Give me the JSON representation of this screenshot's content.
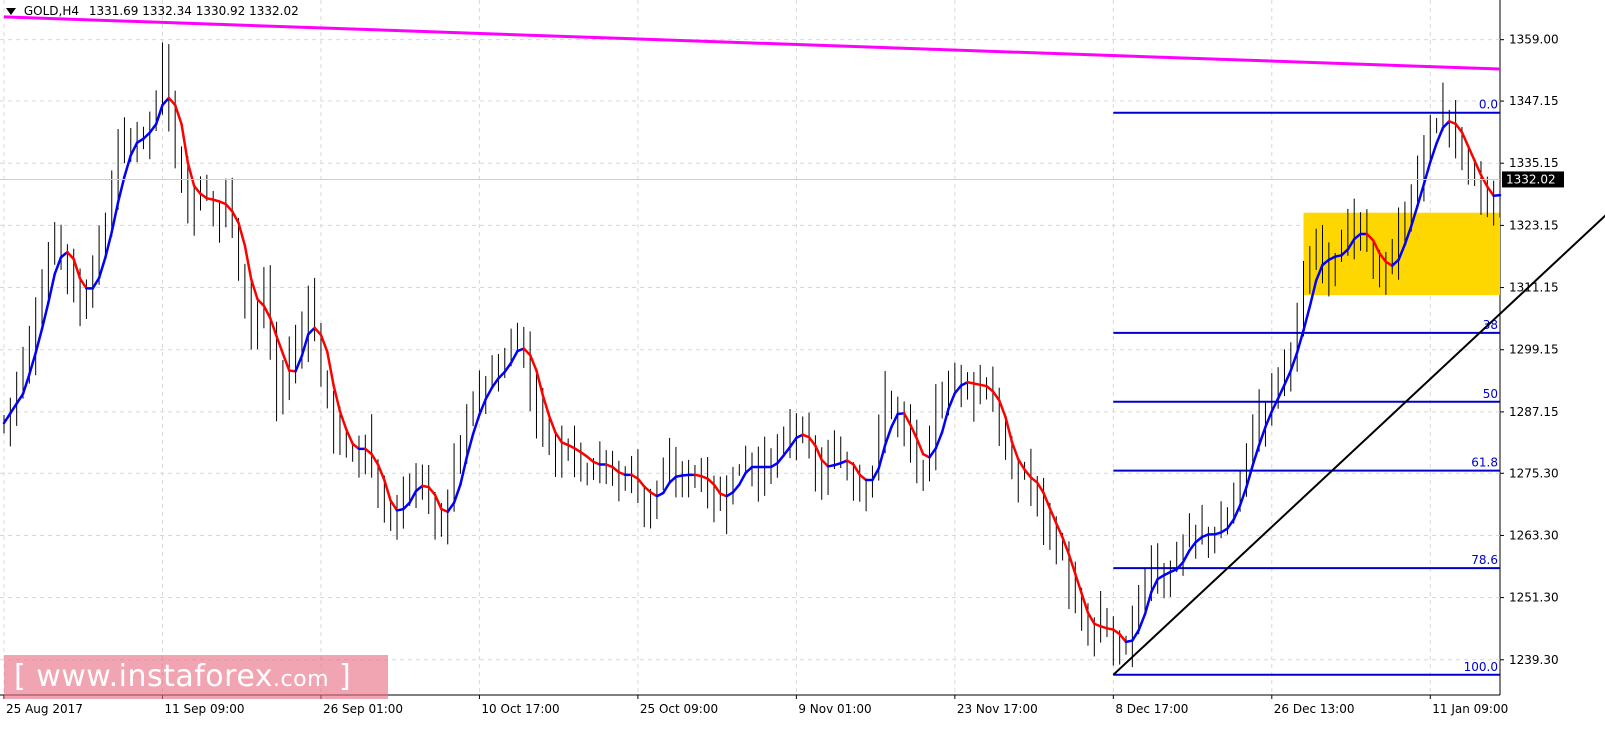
{
  "header": {
    "symbol": "GOLD,H4",
    "ohlc": "1331.69 1332.34 1330.92 1332.02"
  },
  "logo": {
    "open": "[",
    "www": "www.",
    "brand": "instaforex",
    "com": ".com",
    "close": "]"
  },
  "colors": {
    "trend_line": "#ff00ff",
    "fib": "#0000cc",
    "support_line": "#000000",
    "zone": "#ffd700",
    "ma_up": "#0000ff",
    "ma_down": "#ff0000",
    "bars": "#000000",
    "grid": "#d8d8d8"
  },
  "chart_data": {
    "type": "candlestick",
    "instrument": "GOLD",
    "timeframe": "H4",
    "last_price": 1332.02,
    "last_price_label": "1332.02",
    "y_ticks": [
      "1359.00",
      "1347.15",
      "1335.15",
      "1323.15",
      "1311.15",
      "1299.15",
      "1287.15",
      "1275.30",
      "1263.30",
      "1251.30",
      "1239.30"
    ],
    "y_tick_values": [
      1359.0,
      1347.15,
      1335.15,
      1323.15,
      1311.15,
      1299.15,
      1287.15,
      1275.3,
      1263.3,
      1251.3,
      1239.3
    ],
    "ylim": [
      1232.5,
      1365.5
    ],
    "x_labels": [
      "25 Aug 2017",
      "11 Sep 09:00",
      "26 Sep 01:00",
      "10 Oct 17:00",
      "25 Oct 09:00",
      "9 Nov 01:00",
      "23 Nov 17:00",
      "8 Dec 17:00",
      "26 Dec 13:00",
      "11 Jan 09:00"
    ],
    "x_label_index": [
      0,
      25,
      50,
      75,
      100,
      125,
      150,
      175,
      200,
      225
    ],
    "bar_count": 237,
    "price_path": [
      [
        0,
        1285
      ],
      [
        4,
        1300
      ],
      [
        8,
        1322
      ],
      [
        10,
        1315
      ],
      [
        12,
        1307
      ],
      [
        16,
        1323
      ],
      [
        18,
        1338
      ],
      [
        22,
        1341
      ],
      [
        24,
        1346
      ],
      [
        25,
        1355
      ],
      [
        27,
        1338
      ],
      [
        29,
        1325
      ],
      [
        31,
        1332
      ],
      [
        33,
        1324
      ],
      [
        35,
        1330
      ],
      [
        37,
        1315
      ],
      [
        39,
        1304
      ],
      [
        41,
        1310
      ],
      [
        43,
        1290
      ],
      [
        45,
        1297
      ],
      [
        47,
        1302
      ],
      [
        48,
        1310
      ],
      [
        50,
        1294
      ],
      [
        52,
        1284
      ],
      [
        55,
        1278
      ],
      [
        57,
        1282
      ],
      [
        59,
        1270
      ],
      [
        61,
        1266
      ],
      [
        63,
        1271
      ],
      [
        65,
        1275
      ],
      [
        67,
        1270
      ],
      [
        69,
        1264
      ],
      [
        71,
        1277
      ],
      [
        73,
        1285
      ],
      [
        75,
        1292
      ],
      [
        77,
        1294
      ],
      [
        79,
        1297
      ],
      [
        81,
        1303
      ],
      [
        83,
        1292
      ],
      [
        85,
        1284
      ],
      [
        87,
        1279
      ],
      [
        89,
        1282
      ],
      [
        91,
        1276
      ],
      [
        93,
        1278
      ],
      [
        95,
        1276
      ],
      [
        97,
        1274
      ],
      [
        99,
        1276
      ],
      [
        101,
        1268
      ],
      [
        103,
        1273
      ],
      [
        105,
        1276
      ],
      [
        107,
        1274
      ],
      [
        109,
        1276
      ],
      [
        111,
        1272
      ],
      [
        113,
        1269
      ],
      [
        115,
        1275
      ],
      [
        117,
        1278
      ],
      [
        119,
        1275
      ],
      [
        121,
        1278
      ],
      [
        123,
        1281
      ],
      [
        125,
        1285
      ],
      [
        127,
        1279
      ],
      [
        129,
        1274
      ],
      [
        131,
        1280
      ],
      [
        133,
        1276
      ],
      [
        135,
        1272
      ],
      [
        137,
        1276
      ],
      [
        139,
        1290
      ],
      [
        141,
        1286
      ],
      [
        143,
        1281
      ],
      [
        145,
        1274
      ],
      [
        147,
        1288
      ],
      [
        149,
        1292
      ],
      [
        151,
        1294
      ],
      [
        153,
        1291
      ],
      [
        155,
        1293
      ],
      [
        157,
        1284
      ],
      [
        159,
        1274
      ],
      [
        161,
        1276
      ],
      [
        163,
        1270
      ],
      [
        165,
        1264
      ],
      [
        167,
        1259
      ],
      [
        169,
        1249
      ],
      [
        171,
        1244
      ],
      [
        173,
        1247
      ],
      [
        175,
        1243
      ],
      [
        177,
        1241
      ],
      [
        179,
        1251
      ],
      [
        181,
        1258
      ],
      [
        183,
        1254
      ],
      [
        185,
        1260
      ],
      [
        187,
        1263
      ],
      [
        189,
        1264
      ],
      [
        191,
        1263
      ],
      [
        193,
        1267
      ],
      [
        195,
        1274
      ],
      [
        197,
        1284
      ],
      [
        199,
        1288
      ],
      [
        201,
        1294
      ],
      [
        203,
        1299
      ],
      [
        205,
        1311
      ],
      [
        207,
        1319
      ],
      [
        209,
        1315
      ],
      [
        211,
        1320
      ],
      [
        213,
        1323
      ],
      [
        215,
        1320
      ],
      [
        217,
        1313
      ],
      [
        219,
        1317
      ],
      [
        221,
        1325
      ],
      [
        223,
        1333
      ],
      [
        225,
        1342
      ],
      [
        227,
        1345
      ],
      [
        229,
        1340
      ],
      [
        231,
        1334
      ],
      [
        233,
        1329
      ],
      [
        235,
        1327
      ],
      [
        236,
        1332
      ]
    ],
    "fibonacci": {
      "levels": [
        {
          "label": "0.0",
          "price": 1344.9
        },
        {
          "label": "38",
          "price": 1302.4
        },
        {
          "label": "50",
          "price": 1289.1
        },
        {
          "label": "61.8",
          "price": 1275.8
        },
        {
          "label": "78.6",
          "price": 1257.0
        },
        {
          "label": "100.0",
          "price": 1236.4
        }
      ],
      "start_bar": 175
    },
    "resistance_trendline": {
      "from": [
        0,
        1363.4
      ],
      "to": [
        293,
        1350.9
      ]
    },
    "support_trendline": {
      "from": [
        175,
        1236.4
      ],
      "to": [
        270,
        1344.9
      ]
    },
    "highlight_zone": {
      "x_from": 205,
      "x_to": 236,
      "y_from": 1309.7,
      "y_to": 1325.6
    }
  }
}
